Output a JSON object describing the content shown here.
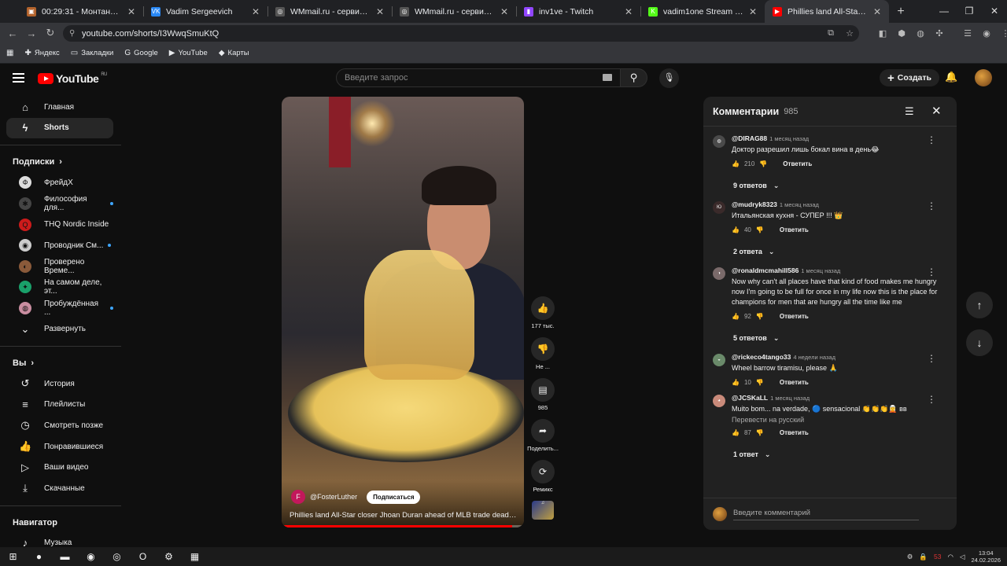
{
  "browser": {
    "tabs": [
      {
        "title": "00:29:31 - Монтана - The West",
        "fav_color": "#b3632c",
        "fav": "▣"
      },
      {
        "title": "Vadim Sergeevich",
        "fav_color": "#2787f5",
        "fav": "VK"
      },
      {
        "title": "WMmail.ru - сервис почтовых",
        "fav_color": "#555555",
        "fav": "◎"
      },
      {
        "title": "WMmail.ru - сервис почтовых",
        "fav_color": "#555555",
        "fav": "◎"
      },
      {
        "title": "inv1ve - Twitch",
        "fav_color": "#9146ff",
        "fav": "▮"
      },
      {
        "title": "vadim1one Stream - Watch Live",
        "fav_color": "#53fc18",
        "fav": "K"
      },
      {
        "title": "Phillies land All-Star closer",
        "fav_color": "#ff0000",
        "fav": "▶",
        "active": true
      }
    ],
    "url": "youtube.com/shorts/I3WwqSmuKtQ",
    "bookmarks": [
      {
        "icon": "✚",
        "label": "Яндекс"
      },
      {
        "icon": "▭",
        "label": "Закладки"
      },
      {
        "icon": "G",
        "label": "Google"
      },
      {
        "icon": "▶",
        "label": "YouTube"
      },
      {
        "icon": "◆",
        "label": "Карты"
      }
    ]
  },
  "header": {
    "logo_text": "YouTube",
    "logo_region": "RU",
    "search_placeholder": "Введите запрос",
    "create_label": "Создать"
  },
  "sidebar": {
    "main": [
      {
        "icon": "⌂",
        "label": "Главная"
      },
      {
        "icon": "ϟ",
        "label": "Shorts",
        "selected": true
      }
    ],
    "subs_title": "Подписки",
    "subs": [
      {
        "label": "ФрейдХ",
        "color": "#dddddd",
        "glyph": "Ф",
        "dot": false
      },
      {
        "label": "Философия для...",
        "color": "#444444",
        "glyph": "✱",
        "dot": true
      },
      {
        "label": "THQ Nordic Inside",
        "color": "#cc1b1b",
        "glyph": "Q",
        "dot": false
      },
      {
        "label": "Проводник См...",
        "color": "#cccccc",
        "glyph": "◉",
        "dot": true
      },
      {
        "label": "Проверено Време...",
        "color": "#8a5a3a",
        "glyph": "◐",
        "dot": false
      },
      {
        "label": "На самом деле, эт...",
        "color": "#1aa06a",
        "glyph": "✦",
        "dot": false
      },
      {
        "label": "Пробуждённая ...",
        "color": "#c98da0",
        "glyph": "◍",
        "dot": true
      }
    ],
    "expand_label": "Развернуть",
    "you_title": "Вы",
    "you": [
      {
        "icon": "↺",
        "label": "История"
      },
      {
        "icon": "≡",
        "label": "Плейлисты"
      },
      {
        "icon": "◷",
        "label": "Смотреть позже"
      },
      {
        "icon": "👍",
        "label": "Понравившиеся"
      },
      {
        "icon": "▷",
        "label": "Ваши видео"
      },
      {
        "icon": "⤓",
        "label": "Скачанные"
      }
    ],
    "navigator_title": "Навигатор",
    "navigator": [
      {
        "icon": "♪",
        "label": "Музыка"
      }
    ]
  },
  "video": {
    "author": "@FosterLuther",
    "author_initial": "F",
    "subscribe_label": "Подписаться",
    "title": "Phillies land All-Star closer Jhoan Duran ahead of MLB trade deadli...",
    "progress": 0.95
  },
  "actions": [
    {
      "icon": "👍",
      "label": "177 тыс."
    },
    {
      "icon": "👎",
      "label": "Не ..."
    },
    {
      "icon": "▤",
      "label": "985"
    },
    {
      "icon": "➦",
      "label": "Поделить..."
    },
    {
      "icon": "⟳",
      "label": "Ремикс"
    }
  ],
  "comments_panel": {
    "title": "Комментарии",
    "count": "985",
    "input_placeholder": "Введите комментарий",
    "reply_label": "Ответить",
    "comments": [
      {
        "author": "@DIRAG88",
        "time": "1 месяц назад",
        "text": "Доктор разрешил лишь бокал вина в день😂",
        "likes": "210",
        "replies": "9 ответов",
        "avatar_color": "#4a4a4a",
        "avatar": "◍"
      },
      {
        "author": "@mudryk8323",
        "time": "1 месяц назад",
        "text": "Итальянская кухня - СУПЕР !!! 👑",
        "likes": "40",
        "replies": "2 ответа",
        "avatar_color": "#3a2a2a",
        "avatar": "Ю"
      },
      {
        "author": "@ronaldmcmahill586",
        "time": "1 месяц назад",
        "text": "Now why can't all places have that kind of food makes me hungry now I'm going to be full for once in my life now this is the place for champions for men that are hungry all the time like me",
        "likes": "92",
        "replies": "5 ответов",
        "avatar_color": "#7a6a6a",
        "avatar": "◑"
      },
      {
        "author": "@rickeco4tango33",
        "time": "4 недели назад",
        "text": "Wheel barrow tiramisu, please 🙏",
        "likes": "10",
        "replies": "",
        "avatar_color": "#6a8a6a",
        "avatar": "◒"
      },
      {
        "author": "@JCSKaLL",
        "time": "1 месяц назад",
        "text": "Muito bom... na verdade, 🔵 sensacional 👏👏👏🧝 вв",
        "translate": "Перевести на русский",
        "likes": "87",
        "replies": "1 ответ",
        "avatar_color": "#c98a7a",
        "avatar": "◕"
      }
    ]
  },
  "taskbar": {
    "apps": [
      "⊞",
      "●",
      "▬",
      "◉",
      "◎",
      "O",
      "⚙",
      "▦"
    ],
    "time": "13:04",
    "date": "24.02.2026",
    "tray": "53"
  }
}
